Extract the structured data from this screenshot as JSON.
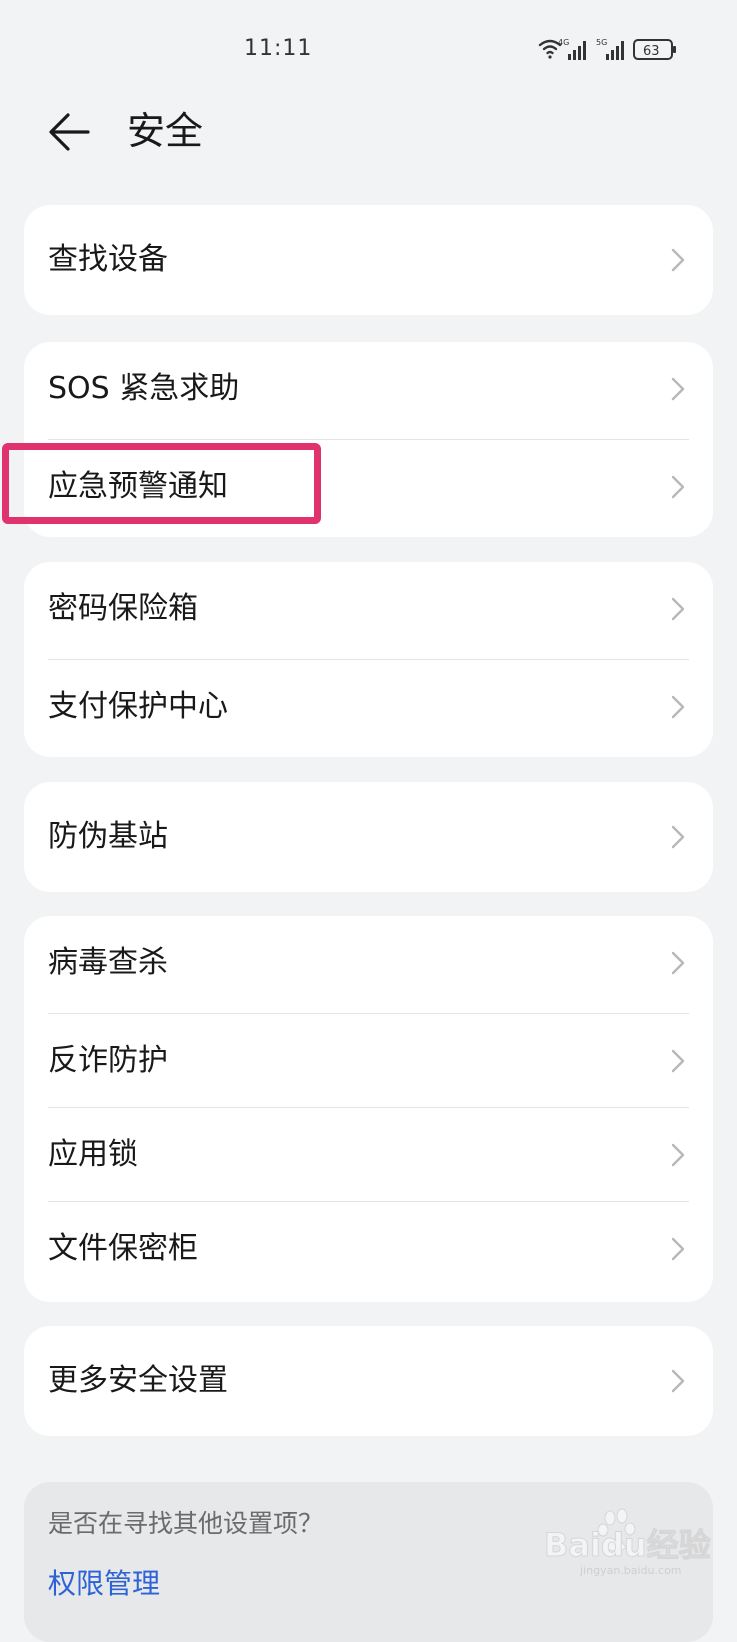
{
  "status_bar": {
    "time": "11:11",
    "network_1": "4G",
    "network_2": "5G",
    "battery": "63"
  },
  "header": {
    "title": "安全"
  },
  "groups": [
    {
      "items": [
        {
          "label": "查找设备"
        }
      ]
    },
    {
      "items": [
        {
          "label": "SOS 紧急求助"
        },
        {
          "label": "应急预警通知"
        }
      ]
    },
    {
      "items": [
        {
          "label": "密码保险箱"
        },
        {
          "label": "支付保护中心"
        }
      ]
    },
    {
      "items": [
        {
          "label": "防伪基站"
        }
      ]
    },
    {
      "items": [
        {
          "label": "病毒查杀"
        },
        {
          "label": "反诈防护"
        },
        {
          "label": "应用锁"
        },
        {
          "label": "文件保密柜"
        }
      ]
    },
    {
      "items": [
        {
          "label": "更多安全设置"
        }
      ]
    }
  ],
  "suggestion": {
    "question": "是否在寻找其他设置项？",
    "link": "权限管理"
  },
  "watermark": {
    "text": "Baidu经验",
    "sub": "jingyan.baidu.com"
  },
  "colors": {
    "background": "#f1f3f5",
    "card": "#ffffff",
    "highlight": "#e0336e",
    "link": "#2d63d6"
  }
}
